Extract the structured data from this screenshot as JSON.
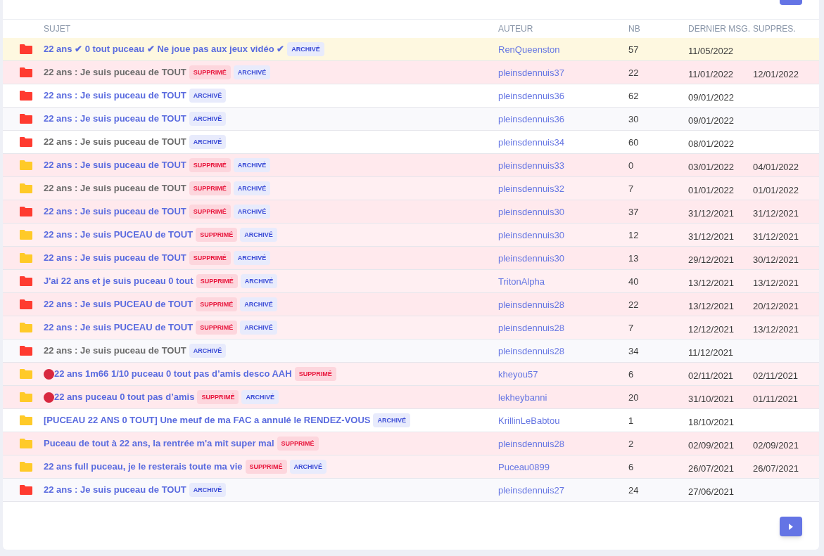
{
  "table": {
    "columns": [
      "SUJET",
      "AUTEUR",
      "NB",
      "DERNIER MSG.",
      "SUPPRES."
    ],
    "rows": [
      {
        "pinned": true,
        "deleted": false,
        "visited": false,
        "dot": false,
        "color": "#ff3b30",
        "title": "22 ans ✔ 0 tout puceau ✔ Ne joue pas aux jeux vidéo ✔",
        "tags": [
          {
            "kind": "archived",
            "label": "ARCHIVÉ"
          }
        ],
        "author": "RenQueenston",
        "count": "57",
        "last_message": "11/05/2022"
      },
      {
        "pinned": false,
        "deleted": true,
        "visited": true,
        "dot": false,
        "color": "#ff3b30",
        "title": "22 ans : Je suis puceau de TOUT",
        "tags": [
          {
            "kind": "deleted",
            "label": "SUPPRIMÉ"
          },
          {
            "kind": "archived",
            "label": "ARCHIVÉ"
          }
        ],
        "author": "pleinsdennuis37",
        "count": "22",
        "last_message": "11/01/2022",
        "deleted_on": "12/01/2022"
      },
      {
        "pinned": false,
        "deleted": false,
        "visited": false,
        "dot": false,
        "color": "#ff3b30",
        "title": "22 ans : Je suis puceau de TOUT",
        "tags": [
          {
            "kind": "archived",
            "label": "ARCHIVÉ"
          }
        ],
        "author": "pleinsdennuis36",
        "count": "62",
        "last_message": "09/01/2022"
      },
      {
        "pinned": false,
        "deleted": false,
        "visited": false,
        "dot": false,
        "color": "#ff3b30",
        "title": "22 ans : Je suis puceau de TOUT",
        "tags": [
          {
            "kind": "archived",
            "label": "ARCHIVÉ"
          }
        ],
        "author": "pleinsdennuis36",
        "count": "30",
        "last_message": "09/01/2022"
      },
      {
        "pinned": false,
        "deleted": false,
        "visited": true,
        "dot": false,
        "color": "#ff3b30",
        "title": "22 ans : Je suis puceau de TOUT",
        "tags": [
          {
            "kind": "archived",
            "label": "ARCHIVÉ"
          }
        ],
        "author": "pleinsdennuis34",
        "count": "60",
        "last_message": "08/01/2022"
      },
      {
        "pinned": false,
        "deleted": true,
        "visited": false,
        "dot": false,
        "color": "#ffca28",
        "title": "22 ans : Je suis puceau de TOUT",
        "tags": [
          {
            "kind": "deleted",
            "label": "SUPPRIMÉ"
          },
          {
            "kind": "archived",
            "label": "ARCHIVÉ"
          }
        ],
        "author": "pleinsdennuis33",
        "count": "0",
        "last_message": "03/01/2022",
        "deleted_on": "04/01/2022"
      },
      {
        "pinned": false,
        "deleted": true,
        "visited": true,
        "dot": false,
        "color": "#ffca28",
        "title": "22 ans : Je suis puceau de TOUT",
        "tags": [
          {
            "kind": "deleted",
            "label": "SUPPRIMÉ"
          },
          {
            "kind": "archived",
            "label": "ARCHIVÉ"
          }
        ],
        "author": "pleinsdennuis32",
        "count": "7",
        "last_message": "01/01/2022",
        "deleted_on": "01/01/2022"
      },
      {
        "pinned": false,
        "deleted": true,
        "visited": false,
        "dot": false,
        "color": "#ff3b30",
        "title": "22 ans : Je suis puceau de TOUT",
        "tags": [
          {
            "kind": "deleted",
            "label": "SUPPRIMÉ"
          },
          {
            "kind": "archived",
            "label": "ARCHIVÉ"
          }
        ],
        "author": "pleinsdennuis30",
        "count": "37",
        "last_message": "31/12/2021",
        "deleted_on": "31/12/2021"
      },
      {
        "pinned": false,
        "deleted": true,
        "visited": false,
        "dot": false,
        "color": "#ffca28",
        "title": "22 ans : Je suis PUCEAU de TOUT",
        "tags": [
          {
            "kind": "deleted",
            "label": "SUPPRIMÉ"
          },
          {
            "kind": "archived",
            "label": "ARCHIVÉ"
          }
        ],
        "author": "pleinsdennuis30",
        "count": "12",
        "last_message": "31/12/2021",
        "deleted_on": "31/12/2021"
      },
      {
        "pinned": false,
        "deleted": true,
        "visited": false,
        "dot": false,
        "color": "#ffca28",
        "title": "22 ans : Je suis puceau de TOUT",
        "tags": [
          {
            "kind": "deleted",
            "label": "SUPPRIMÉ"
          },
          {
            "kind": "archived",
            "label": "ARCHIVÉ"
          }
        ],
        "author": "pleinsdennuis30",
        "count": "13",
        "last_message": "29/12/2021",
        "deleted_on": "30/12/2021"
      },
      {
        "pinned": false,
        "deleted": true,
        "visited": false,
        "dot": false,
        "color": "#ff3b30",
        "title": "J'ai 22 ans et je suis puceau 0 tout",
        "tags": [
          {
            "kind": "deleted",
            "label": "SUPPRIMÉ"
          },
          {
            "kind": "archived",
            "label": "ARCHIVÉ"
          }
        ],
        "author": "TritonAlpha",
        "count": "40",
        "last_message": "13/12/2021",
        "deleted_on": "13/12/2021"
      },
      {
        "pinned": false,
        "deleted": true,
        "visited": false,
        "dot": false,
        "color": "#ff3b30",
        "title": "22 ans : Je suis PUCEAU de TOUT",
        "tags": [
          {
            "kind": "deleted",
            "label": "SUPPRIMÉ"
          },
          {
            "kind": "archived",
            "label": "ARCHIVÉ"
          }
        ],
        "author": "pleinsdennuis28",
        "count": "22",
        "last_message": "13/12/2021",
        "deleted_on": "20/12/2021"
      },
      {
        "pinned": false,
        "deleted": true,
        "visited": false,
        "dot": false,
        "color": "#ffca28",
        "title": "22 ans : Je suis PUCEAU de TOUT",
        "tags": [
          {
            "kind": "deleted",
            "label": "SUPPRIMÉ"
          },
          {
            "kind": "archived",
            "label": "ARCHIVÉ"
          }
        ],
        "author": "pleinsdennuis28",
        "count": "7",
        "last_message": "12/12/2021",
        "deleted_on": "13/12/2021"
      },
      {
        "pinned": false,
        "deleted": false,
        "visited": true,
        "dot": false,
        "color": "#ff3b30",
        "title": "22 ans : Je suis puceau de TOUT",
        "tags": [
          {
            "kind": "archived",
            "label": "ARCHIVÉ"
          }
        ],
        "author": "pleinsdennuis28",
        "count": "34",
        "last_message": "11/12/2021"
      },
      {
        "pinned": false,
        "deleted": true,
        "visited": false,
        "dot": true,
        "color": "#ffca28",
        "title": "22 ans 1m66 1/10 puceau 0 tout pas d’amis desco AAH",
        "tags": [
          {
            "kind": "deleted",
            "label": "SUPPRIMÉ"
          }
        ],
        "author": "kheyou57",
        "count": "6",
        "last_message": "02/11/2021",
        "deleted_on": "02/11/2021"
      },
      {
        "pinned": false,
        "deleted": true,
        "visited": false,
        "dot": true,
        "color": "#ffca28",
        "title": "22 ans puceau 0 tout pas d’amis",
        "tags": [
          {
            "kind": "deleted",
            "label": "SUPPRIMÉ"
          },
          {
            "kind": "archived",
            "label": "ARCHIVÉ"
          }
        ],
        "author": "lekheybanni",
        "count": "20",
        "last_message": "31/10/2021",
        "deleted_on": "01/11/2021"
      },
      {
        "pinned": false,
        "deleted": false,
        "visited": false,
        "dot": false,
        "color": "#ffca28",
        "title": "[PUCEAU 22 ANS 0 TOUT] Une meuf de ma FAC a annulé le RENDEZ-VOUS",
        "tags": [
          {
            "kind": "archived",
            "label": "ARCHIVÉ"
          }
        ],
        "author": "KrillinLeBabtou",
        "count": "1",
        "last_message": "18/10/2021"
      },
      {
        "pinned": false,
        "deleted": true,
        "visited": false,
        "dot": false,
        "color": "#ffca28",
        "title": "Puceau de tout à 22 ans, la rentrée m'a mit super mal",
        "tags": [
          {
            "kind": "deleted",
            "label": "SUPPRIMÉ"
          }
        ],
        "author": "pleinsdennuis28",
        "count": "2",
        "last_message": "02/09/2021",
        "deleted_on": "02/09/2021"
      },
      {
        "pinned": false,
        "deleted": true,
        "visited": false,
        "dot": false,
        "color": "#ffca28",
        "title": "22 ans full puceau, je le resterais toute ma vie",
        "tags": [
          {
            "kind": "deleted",
            "label": "SUPPRIMÉ"
          },
          {
            "kind": "archived",
            "label": "ARCHIVÉ"
          }
        ],
        "author": "Puceau0899",
        "count": "6",
        "last_message": "26/07/2021",
        "deleted_on": "26/07/2021"
      },
      {
        "pinned": false,
        "deleted": false,
        "visited": false,
        "dot": false,
        "color": "#ff3b30",
        "title": "22 ans : Je suis puceau de TOUT",
        "tags": [
          {
            "kind": "archived",
            "label": "ARCHIVÉ"
          }
        ],
        "author": "pleinsdennuis27",
        "count": "24",
        "last_message": "27/06/2021"
      }
    ]
  }
}
